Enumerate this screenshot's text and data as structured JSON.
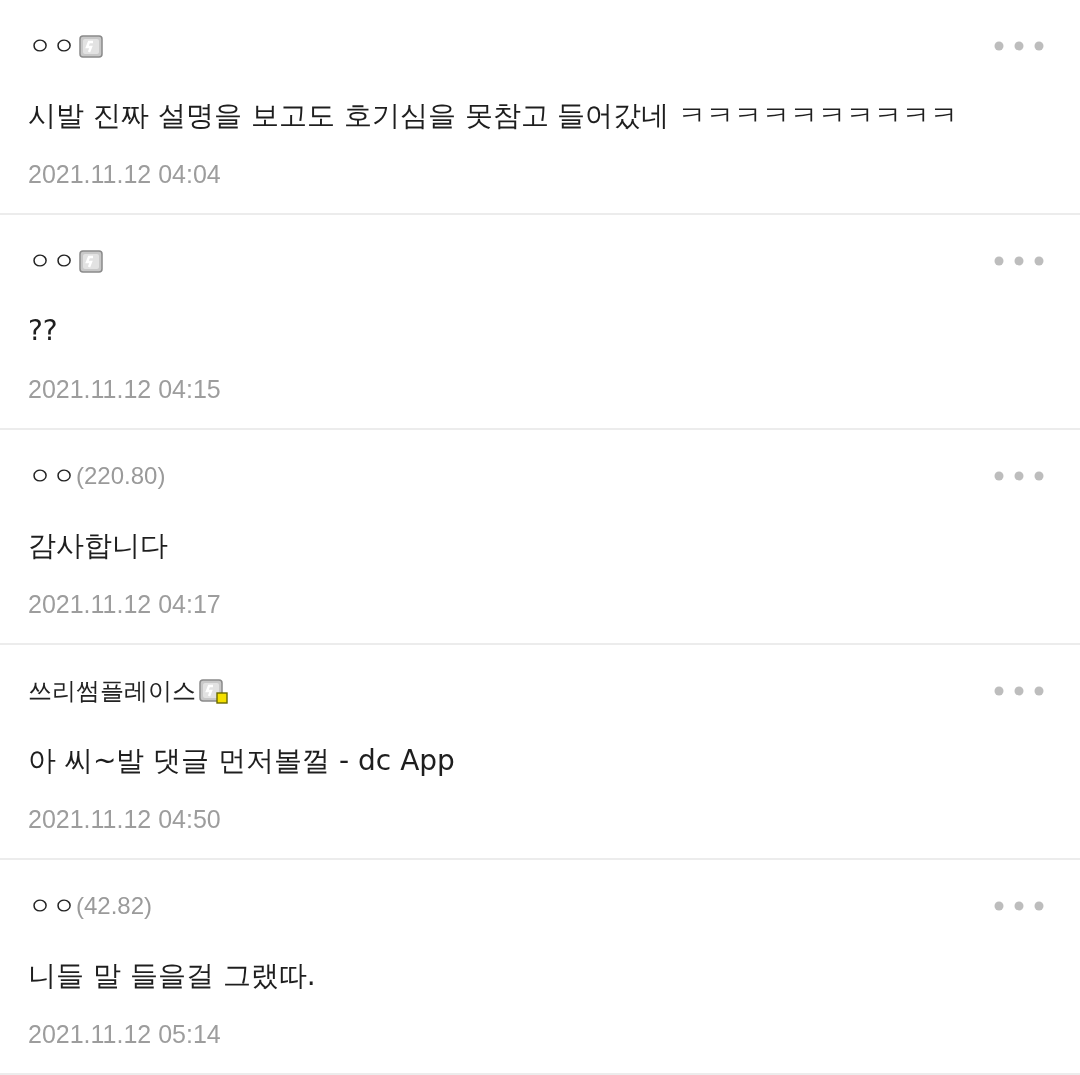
{
  "comments": [
    {
      "author": "ㅇㅇ",
      "badge": {
        "marked": false
      },
      "text": "시발 진짜 설명을 보고도 호기심을 못참고 들어갔네 ㅋㅋㅋㅋㅋㅋㅋㅋㅋㅋ",
      "date": "2021.11.12 04:04"
    },
    {
      "author": "ㅇㅇ",
      "badge": {
        "marked": false
      },
      "text": "??",
      "date": "2021.11.12 04:15"
    },
    {
      "author": "ㅇㅇ",
      "ip": "(220.80)",
      "text": "감사합니다",
      "date": "2021.11.12 04:17"
    },
    {
      "author": "쓰리썸플레이스",
      "badge": {
        "marked": true
      },
      "text": "아 씨~발 댓글 먼저볼껄 - dc App",
      "date": "2021.11.12 04:50"
    },
    {
      "author": "ㅇㅇ",
      "ip": "(42.82)",
      "text": "니들 말 들을걸 그랬따.",
      "date": "2021.11.12 05:14"
    }
  ]
}
